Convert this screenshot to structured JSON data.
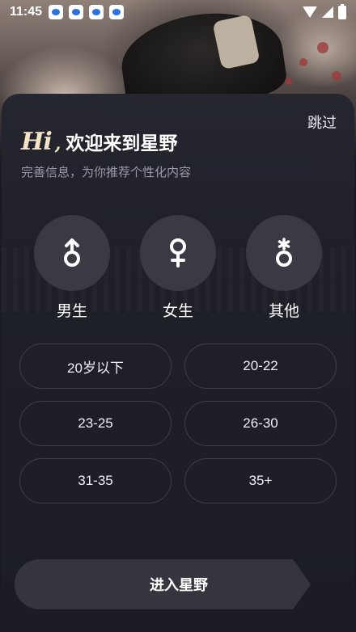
{
  "status_bar": {
    "time": "11:45",
    "notification_icons": [
      "app-notification-icon",
      "app-notification-icon",
      "app-notification-icon",
      "app-notification-icon"
    ],
    "icons": [
      "wifi-icon",
      "signal-icon",
      "battery-charging-icon"
    ]
  },
  "sheet": {
    "skip_label": "跳过",
    "hi_logo": "Hi",
    "hi_comma": ",",
    "title": "欢迎来到星野",
    "subtitle": "完善信息，为你推荐个性化内容"
  },
  "gender_options": [
    {
      "label": "男生",
      "icon": "male-symbol-icon"
    },
    {
      "label": "女生",
      "icon": "female-symbol-icon"
    },
    {
      "label": "其他",
      "icon": "other-gender-symbol-icon"
    }
  ],
  "age_options": [
    "20岁以下",
    "20-22",
    "23-25",
    "26-30",
    "31-35",
    "35+"
  ],
  "enter_button": {
    "label": "进入星野"
  },
  "colors": {
    "sheet_bg": "#1f2028",
    "gender_circle_bg": "#393a43",
    "age_border": "#3e3f48",
    "logo_accent": "#f3e4c8",
    "button_bg": "#34353d",
    "subtitle": "#9a9ba6"
  }
}
